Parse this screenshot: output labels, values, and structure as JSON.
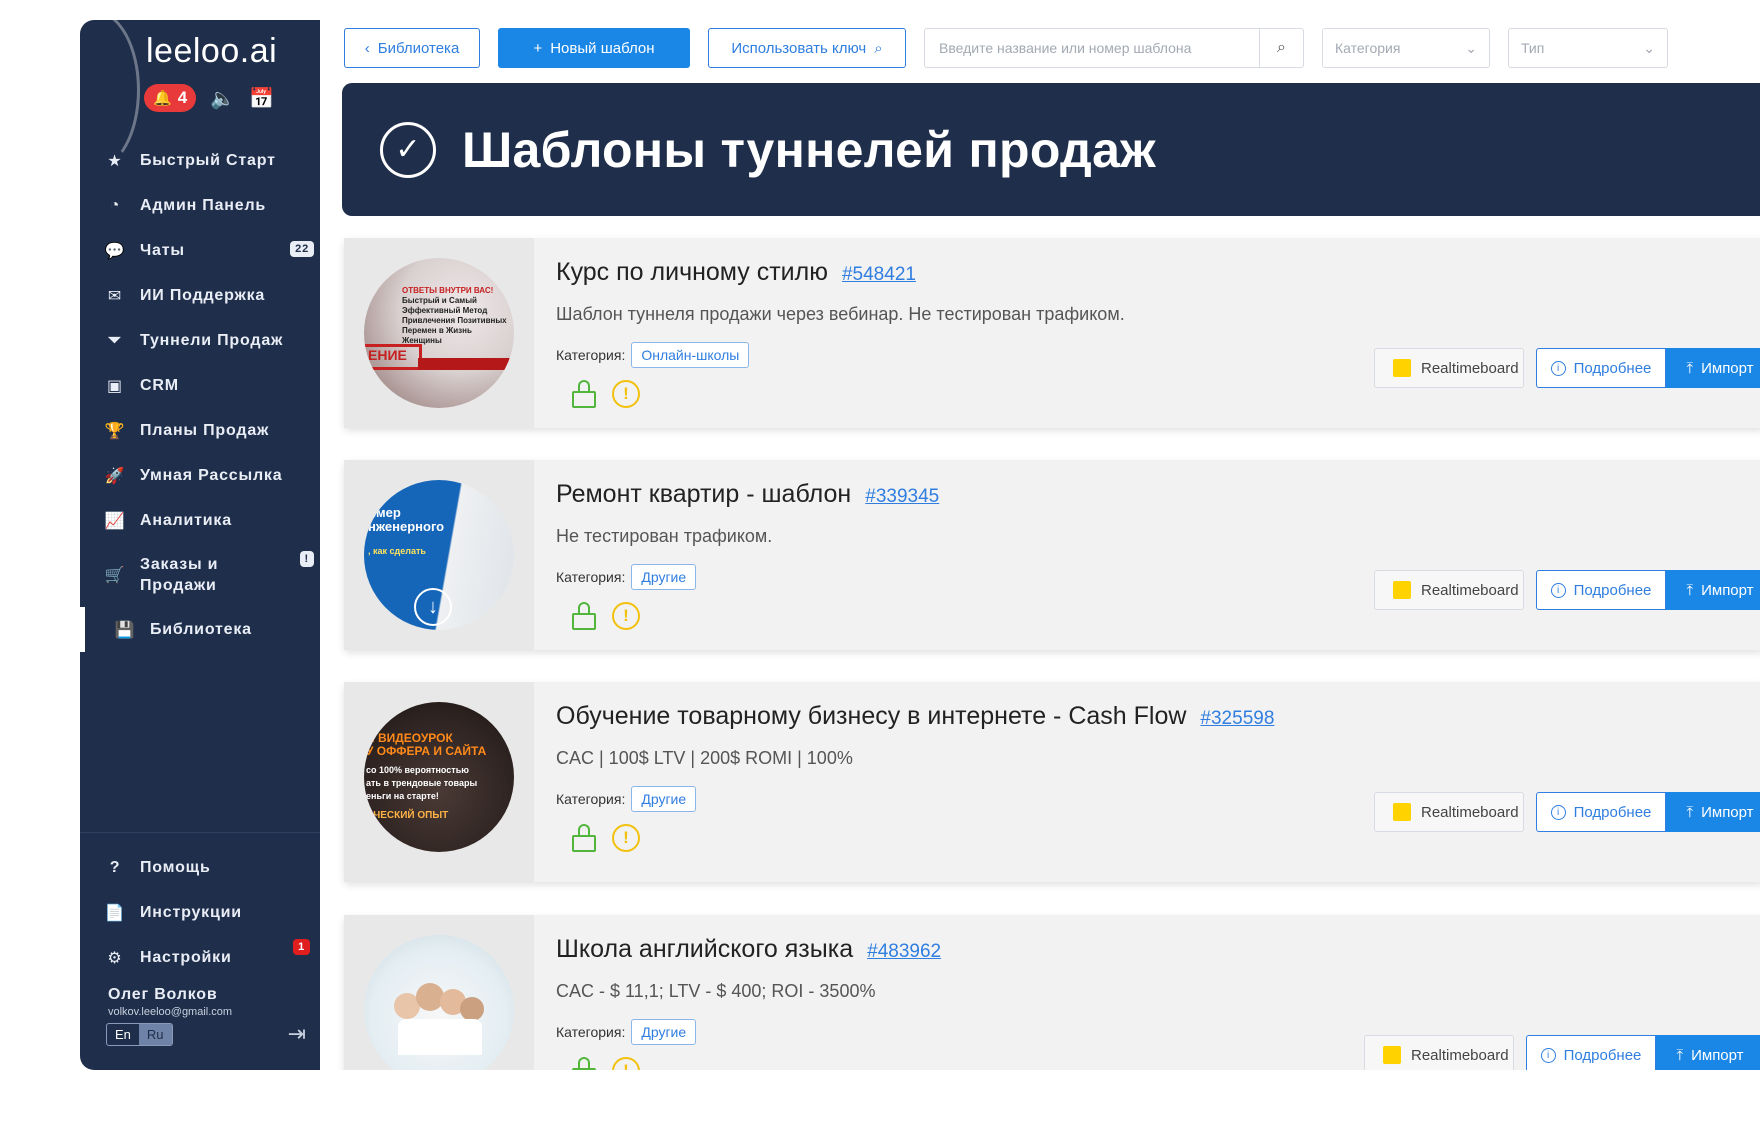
{
  "app": {
    "logo_text": "leeloo.ai",
    "notifications_count": "4"
  },
  "sidebar": {
    "items": [
      {
        "label": "Быстрый Старт",
        "icon": "star-icon"
      },
      {
        "label": "Админ Панель",
        "icon": "dashboard-icon"
      },
      {
        "label": "Чаты",
        "icon": "chat-icon",
        "badge": "22"
      },
      {
        "label": "ИИ Поддержка",
        "icon": "mail-icon"
      },
      {
        "label": "Туннели Продаж",
        "icon": "funnel-icon"
      },
      {
        "label": "CRM",
        "icon": "contacts-icon"
      },
      {
        "label": "Планы Продаж",
        "icon": "trophy-icon"
      },
      {
        "label": "Умная Рассылка",
        "icon": "rocket-icon"
      },
      {
        "label": "Аналитика",
        "icon": "chart-icon"
      },
      {
        "label": "Заказы и Продажи",
        "icon": "cart-icon",
        "badge": "!"
      },
      {
        "label": "Библиотека",
        "icon": "save-icon",
        "active": true
      }
    ],
    "bottom_items": [
      {
        "label": "Помощь",
        "icon": "help-icon"
      },
      {
        "label": "Инструкции",
        "icon": "document-icon"
      },
      {
        "label": "Настройки",
        "icon": "settings-icon",
        "badge": "1"
      }
    ],
    "user": {
      "name": "Олег Волков",
      "email": "volkov.leeloo@gmail.com"
    },
    "lang": {
      "en": "En",
      "ru": "Ru",
      "selected": "Ru"
    }
  },
  "toolbar": {
    "library_label": "Библиотека",
    "new_template_label": "Новый шаблон",
    "use_key_label": "Использовать ключ",
    "search_placeholder": "Введите название или номер шаблона",
    "category_placeholder": "Категория",
    "type_placeholder": "Тип"
  },
  "banner": {
    "title": "Шаблоны туннелей продаж"
  },
  "labels": {
    "category": "Категория:",
    "realtimeboard": "Realtimeboard",
    "details": "Подробнее",
    "import": "Импорт"
  },
  "templates": [
    {
      "name": "Курс по личному стилю",
      "code": "#548421",
      "description": "Шаблон туннеля продажи через вебинар. Не тестирован трафиком.",
      "category": "Онлайн-школы",
      "thumb_lines": [
        "ОТВЕТЫ ВНУТРИ ВАС!",
        "Быстрый и Самый",
        "Эффективный Метод",
        "Привлечения Позитивных",
        "Перемен в Жизнь Женщины",
        "ЕНИЕ"
      ]
    },
    {
      "name": "Ремонт квартир - шаблон",
      "code": "#339345",
      "description": "Не тестирован трафиком.",
      "category": "Другие",
      "thumb_lines": [
        "имер",
        "нженерного",
        ", как сделать"
      ]
    },
    {
      "name": "Обучение товарному бизнесу в интернете - Cash Flow",
      "code": "#325598",
      "description": "CAC | 100$ LTV | 200$ ROMI | 100%",
      "category": "Другие",
      "thumb_lines": [
        "И ВИДЕОУРОК",
        "У ОФФЕРА И САЙТА",
        "со 100% вероятностью",
        "ать в трендовые товары",
        "еньги на старте!",
        "ИЧЕСКИЙ ОПЫТ"
      ]
    },
    {
      "name": "Школа английского языка",
      "code": "#483962",
      "description": "CAC - $ 11,1; LTV - $ 400; ROI - 3500%",
      "category": "Другие",
      "thumb_lines": []
    }
  ],
  "colors": {
    "sidebar_bg": "#1f2e4a",
    "accent": "#1a86e6",
    "lock": "#52b63c",
    "warning": "#f2c10d",
    "badge_red": "#e83a3a"
  }
}
